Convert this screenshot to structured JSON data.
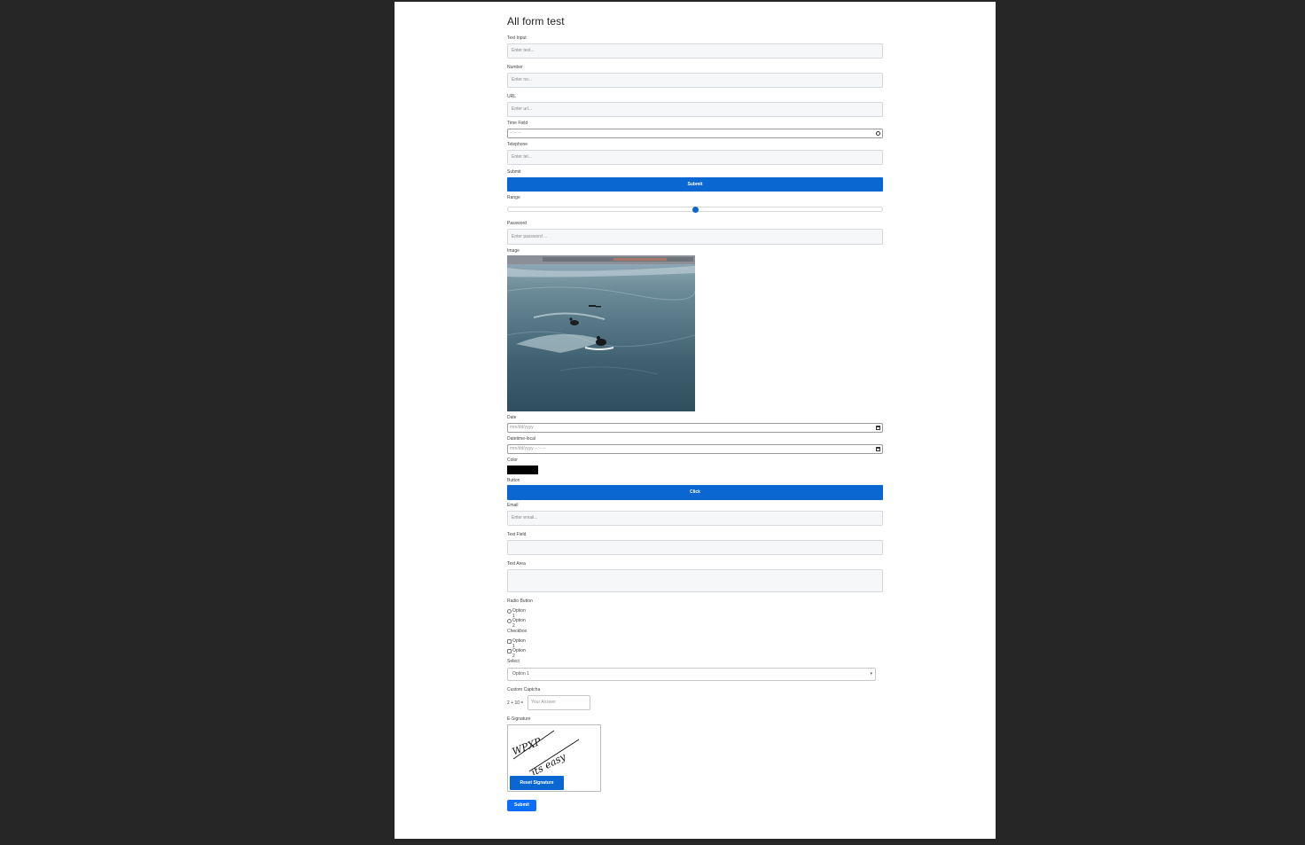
{
  "form": {
    "title": "All form test",
    "text_input": {
      "label": "Text Input",
      "placeholder": "Enter text..."
    },
    "number": {
      "label": "Number",
      "placeholder": "Enter no..."
    },
    "url": {
      "label": "URL",
      "placeholder": "Enter url..."
    },
    "time_field": {
      "label": "Time Field",
      "placeholder": "--:-- --"
    },
    "telephone": {
      "label": "Telephone",
      "placeholder": "Enter tel..."
    },
    "submit_section": {
      "label": "Submit",
      "button": "Submit"
    },
    "range": {
      "label": "Range",
      "value_fraction": 0.5
    },
    "password": {
      "label": "Password",
      "placeholder": "Enter password ..."
    },
    "image": {
      "label": "Image"
    },
    "date": {
      "label": "Date",
      "placeholder": "mm/dd/yyyy"
    },
    "datetime_local": {
      "label": "Datetime-local",
      "placeholder": "mm/dd/yyyy --:-- --"
    },
    "color": {
      "label": "Color",
      "value": "#000000"
    },
    "button_section": {
      "label": "Button",
      "button": "Click"
    },
    "email": {
      "label": "Email",
      "placeholder": "Enter email..."
    },
    "text_field": {
      "label": "Text Field",
      "placeholder": ""
    },
    "text_area": {
      "label": "Text Area",
      "placeholder": ""
    },
    "radio": {
      "label": "Radio Button",
      "options": [
        "Option 1",
        "Option 2"
      ]
    },
    "checkbox": {
      "label": "Checkbox",
      "options": [
        "Option 1",
        "Option 2"
      ]
    },
    "select": {
      "label": "Select",
      "selected": "Option 1"
    },
    "captcha": {
      "label": "Custom Captcha",
      "question": "2 + 10 =",
      "placeholder": "Your Answer"
    },
    "signature": {
      "label": "E-Signature",
      "reset_button": "Reset Signature",
      "signature_text": [
        "WPXP",
        "its easy"
      ]
    },
    "final_submit": "Submit"
  },
  "colors": {
    "primary": "#0a66d1",
    "page_background": "#ffffff",
    "outer_background": "#262626"
  }
}
